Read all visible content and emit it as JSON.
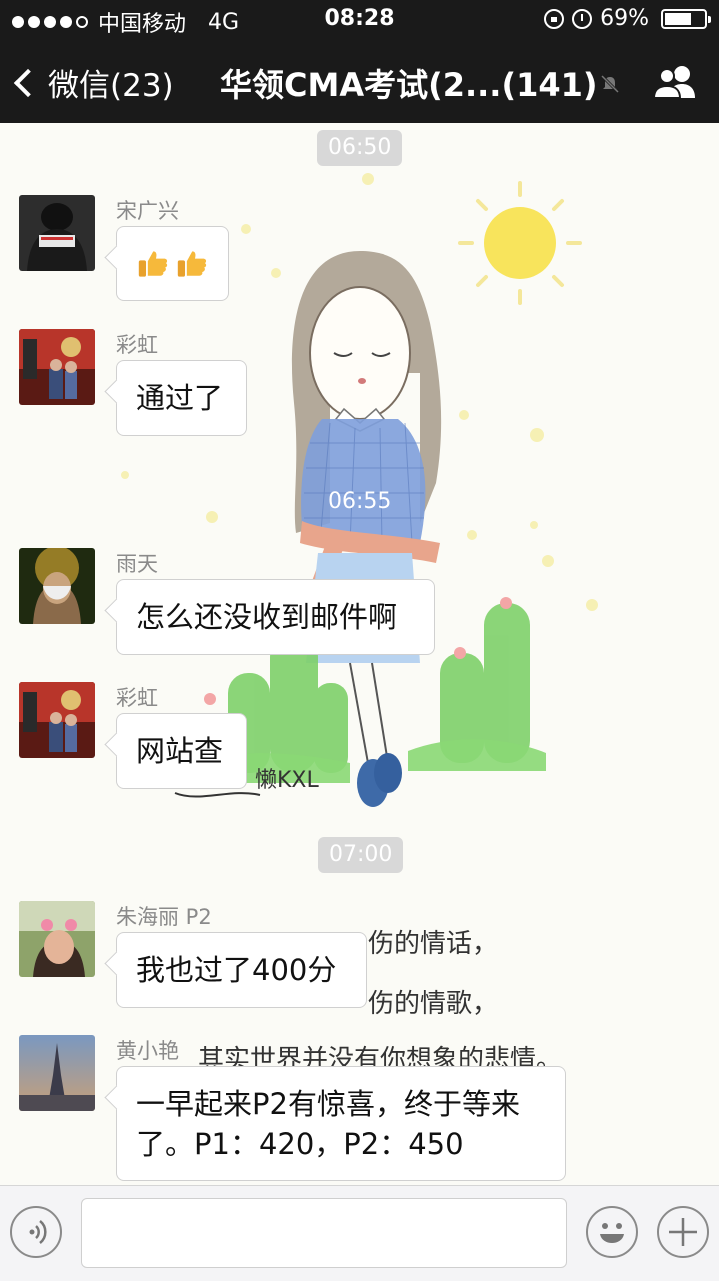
{
  "status_bar": {
    "carrier": "中国移动",
    "network": "4G",
    "time": "08:28",
    "battery_percent": "69%",
    "battery_level": 0.69
  },
  "nav": {
    "back_label": "微信(23)",
    "title": "华领CMA考试(2...(141)"
  },
  "timestamps": [
    "06:50",
    "06:55",
    "07:00"
  ],
  "wallpaper_text": {
    "signature": "懒KXL",
    "line1": "伤的情话，",
    "line2": "伤的情歌，",
    "line3": "其实世界并没有你想象的悲情。"
  },
  "messages": [
    {
      "sender": "宋广兴",
      "text": "👍👍",
      "type": "emoji"
    },
    {
      "sender": "彩虹",
      "text": "通过了"
    },
    {
      "sender": "雨天",
      "text": "怎么还没收到邮件啊"
    },
    {
      "sender": "彩虹",
      "text": "网站查"
    },
    {
      "sender": "朱海丽 P2",
      "text": "我也过了400分"
    },
    {
      "sender": "黄小艳",
      "text": "一早起来P2有惊喜，终于等来了。P1：420，P2：450"
    }
  ],
  "icons": {
    "back": "chevron-left-icon",
    "mute": "mute-bell-icon",
    "group": "group-members-icon",
    "voice": "voice-icon",
    "emoji": "emoji-icon",
    "add": "plus-icon"
  },
  "colors": {
    "nav_background": "#1a1a1a",
    "timestamp_pill": "#d8d8d8",
    "bubble_background": "#ffffff"
  }
}
